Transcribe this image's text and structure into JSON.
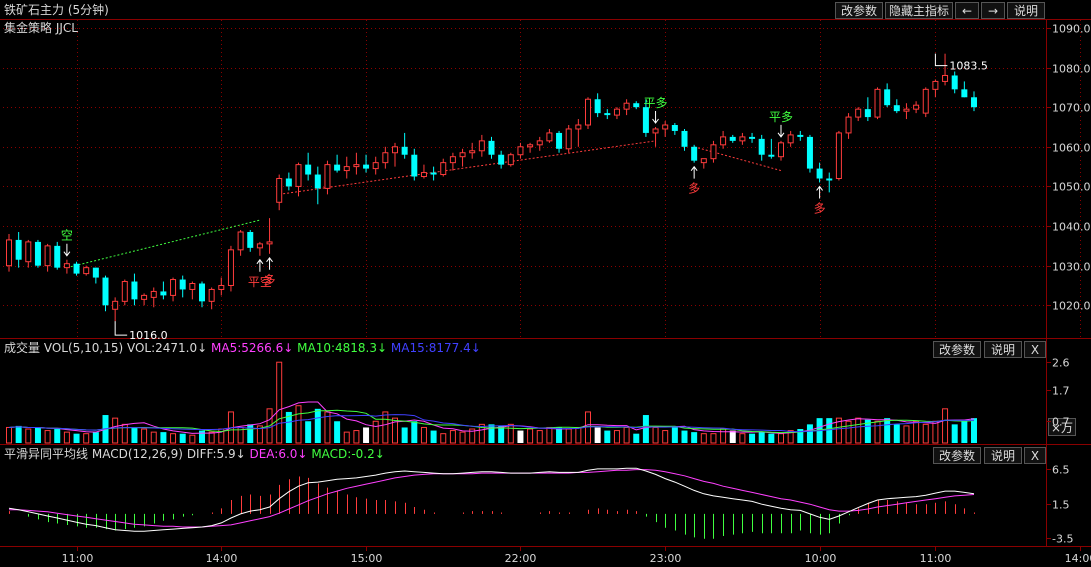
{
  "title": "铁矿石主力 (5分钟)",
  "strategy": "集金策略 JJCL",
  "toolbar": {
    "params": "改参数",
    "hide_main": "隐藏主指标",
    "left_arrow": "←",
    "right_arrow": "→",
    "help": "说明"
  },
  "vol_header": {
    "name": "成交量",
    "indicator": "VOL(5,10,15)",
    "vol": "VOL:2471.0↓",
    "ma5": "MA5:5266.6↓",
    "ma10": "MA10:4818.3↓",
    "ma15": "MA15:8177.4↓"
  },
  "vol_buttons": {
    "params": "改参数",
    "help": "说明",
    "close": "X"
  },
  "macd_header": {
    "name": "平滑异同平均线",
    "indicator": "MACD(12,26,9)",
    "diff": "DIFF:5.9↓",
    "dea": "DEA:6.0↓",
    "macd": "MACD:-0.2↓"
  },
  "macd_buttons": {
    "params": "改参数",
    "help": "说明",
    "close": "X"
  },
  "unit_label": "×万",
  "colors": {
    "up": "#ff3c3c",
    "down": "#00ffff",
    "ma5": "#ff40ff",
    "ma10": "#40ff40",
    "ma15": "#4040ff",
    "diff": "#ffffff",
    "dea": "#ff40ff",
    "signal_long": "#ff3c3c",
    "signal_flat": "#40ff40",
    "grid": "#8a0000",
    "axis_text": "#d8d8d8"
  },
  "chart_data": [
    {
      "type": "candlestick",
      "title": "铁矿石主力 (5分钟)",
      "y_ticks": [
        1020.0,
        1030.0,
        1040.0,
        1050.0,
        1060.0,
        1070.0,
        1080.0,
        1090.0
      ],
      "ylim": [
        1012,
        1092
      ],
      "ohlc": [
        [
          1030.0,
          1038.0,
          1028.5,
          1036.5
        ],
        [
          1036.5,
          1038.5,
          1029.5,
          1031.5
        ],
        [
          1031.0,
          1036.5,
          1029.5,
          1036.0
        ],
        [
          1036.0,
          1036.5,
          1029.5,
          1030.0
        ],
        [
          1030.0,
          1035.5,
          1028.5,
          1035.0
        ],
        [
          1035.0,
          1036.0,
          1029.0,
          1029.5
        ],
        [
          1029.5,
          1031.5,
          1028.0,
          1030.5
        ],
        [
          1030.5,
          1031.0,
          1027.5,
          1028.0
        ],
        [
          1028.0,
          1030.0,
          1027.5,
          1029.5
        ],
        [
          1029.5,
          1029.5,
          1025.5,
          1027.0
        ],
        [
          1027.0,
          1027.5,
          1018.5,
          1020.0
        ],
        [
          1019.0,
          1022.0,
          1016.0,
          1021.0
        ],
        [
          1021.0,
          1026.5,
          1020.0,
          1026.0
        ],
        [
          1026.0,
          1028.0,
          1020.0,
          1021.5
        ],
        [
          1021.5,
          1023.0,
          1020.0,
          1022.5
        ],
        [
          1022.0,
          1024.5,
          1019.5,
          1023.5
        ],
        [
          1023.5,
          1026.0,
          1021.5,
          1022.5
        ],
        [
          1022.5,
          1027.0,
          1021.0,
          1026.5
        ],
        [
          1026.5,
          1027.5,
          1022.0,
          1024.0
        ],
        [
          1024.0,
          1026.0,
          1021.5,
          1025.5
        ],
        [
          1025.5,
          1026.0,
          1019.5,
          1021.0
        ],
        [
          1021.0,
          1024.5,
          1019.0,
          1024.0
        ],
        [
          1024.0,
          1027.0,
          1022.5,
          1025.0
        ],
        [
          1025.0,
          1035.0,
          1023.5,
          1034.0
        ],
        [
          1034.0,
          1039.0,
          1032.5,
          1038.5
        ],
        [
          1038.5,
          1039.0,
          1033.5,
          1034.5
        ],
        [
          1034.5,
          1036.0,
          1032.5,
          1035.5
        ],
        [
          1035.5,
          1042.0,
          1033.0,
          1036.0
        ],
        [
          1046.0,
          1053.0,
          1044.0,
          1052.0
        ],
        [
          1052.0,
          1053.5,
          1049.0,
          1050.0
        ],
        [
          1050.0,
          1056.0,
          1047.5,
          1055.5
        ],
        [
          1055.5,
          1058.5,
          1051.5,
          1053.0
        ],
        [
          1053.0,
          1055.0,
          1045.5,
          1049.5
        ],
        [
          1049.5,
          1056.5,
          1048.0,
          1055.5
        ],
        [
          1055.5,
          1058.0,
          1053.5,
          1054.0
        ],
        [
          1054.0,
          1057.5,
          1052.0,
          1055.0
        ],
        [
          1055.0,
          1058.5,
          1053.0,
          1055.5
        ],
        [
          1055.5,
          1058.0,
          1053.5,
          1054.5
        ],
        [
          1054.5,
          1057.5,
          1053.0,
          1056.0
        ],
        [
          1056.0,
          1060.0,
          1054.5,
          1058.5
        ],
        [
          1058.5,
          1061.0,
          1055.0,
          1060.0
        ],
        [
          1060.0,
          1063.5,
          1057.0,
          1058.0
        ],
        [
          1058.0,
          1059.5,
          1051.5,
          1052.5
        ],
        [
          1052.5,
          1055.5,
          1052.0,
          1053.5
        ],
        [
          1053.5,
          1055.0,
          1051.5,
          1053.0
        ],
        [
          1053.0,
          1057.0,
          1052.5,
          1056.0
        ],
        [
          1056.0,
          1058.5,
          1054.0,
          1057.5
        ],
        [
          1057.5,
          1059.5,
          1055.0,
          1058.5
        ],
        [
          1058.5,
          1061.0,
          1057.0,
          1059.0
        ],
        [
          1059.0,
          1063.0,
          1057.5,
          1061.5
        ],
        [
          1061.5,
          1062.5,
          1057.0,
          1058.0
        ],
        [
          1058.0,
          1059.0,
          1054.5,
          1055.5
        ],
        [
          1055.5,
          1058.5,
          1055.0,
          1058.0
        ],
        [
          1058.0,
          1061.0,
          1057.0,
          1060.0
        ],
        [
          1060.0,
          1061.0,
          1058.5,
          1060.5
        ],
        [
          1060.5,
          1062.5,
          1059.0,
          1061.5
        ],
        [
          1061.5,
          1064.5,
          1061.0,
          1063.5
        ],
        [
          1063.5,
          1064.0,
          1058.5,
          1059.5
        ],
        [
          1059.5,
          1065.5,
          1058.5,
          1064.5
        ],
        [
          1064.5,
          1067.0,
          1060.0,
          1065.5
        ],
        [
          1065.5,
          1072.5,
          1064.5,
          1072.0
        ],
        [
          1072.0,
          1073.5,
          1067.5,
          1068.5
        ],
        [
          1068.5,
          1069.5,
          1067.0,
          1068.0
        ],
        [
          1068.0,
          1070.0,
          1067.0,
          1069.5
        ],
        [
          1069.5,
          1072.0,
          1068.0,
          1071.0
        ],
        [
          1071.0,
          1071.5,
          1069.5,
          1070.0
        ],
        [
          1070.0,
          1072.0,
          1062.5,
          1063.5
        ],
        [
          1063.5,
          1065.0,
          1060.0,
          1064.5
        ],
        [
          1064.5,
          1066.5,
          1062.5,
          1065.5
        ],
        [
          1065.5,
          1066.0,
          1063.0,
          1064.0
        ],
        [
          1064.0,
          1064.5,
          1059.0,
          1060.0
        ],
        [
          1060.0,
          1060.5,
          1056.0,
          1056.5
        ],
        [
          1056.0,
          1057.0,
          1054.5,
          1057.0
        ],
        [
          1057.0,
          1061.5,
          1056.0,
          1060.5
        ],
        [
          1060.5,
          1064.0,
          1059.5,
          1062.5
        ],
        [
          1062.5,
          1063.0,
          1061.0,
          1061.5
        ],
        [
          1061.5,
          1063.5,
          1060.5,
          1062.5
        ],
        [
          1062.5,
          1063.5,
          1061.0,
          1062.0
        ],
        [
          1062.0,
          1063.0,
          1056.5,
          1058.0
        ],
        [
          1058.0,
          1062.0,
          1057.0,
          1057.5
        ],
        [
          1057.5,
          1061.5,
          1056.5,
          1061.0
        ],
        [
          1061.0,
          1064.0,
          1060.0,
          1063.0
        ],
        [
          1063.0,
          1064.0,
          1061.5,
          1062.5
        ],
        [
          1062.5,
          1063.0,
          1053.5,
          1054.5
        ],
        [
          1054.5,
          1056.0,
          1051.0,
          1052.0
        ],
        [
          1052.0,
          1053.5,
          1048.5,
          1051.5
        ],
        [
          1052.0,
          1064.0,
          1051.5,
          1063.5
        ],
        [
          1063.5,
          1068.5,
          1062.0,
          1067.5
        ],
        [
          1067.5,
          1070.0,
          1066.5,
          1069.5
        ],
        [
          1069.5,
          1072.5,
          1066.5,
          1067.5
        ],
        [
          1067.5,
          1075.0,
          1067.0,
          1074.5
        ],
        [
          1074.5,
          1076.0,
          1070.0,
          1070.5
        ],
        [
          1070.5,
          1072.0,
          1068.5,
          1069.0
        ],
        [
          1069.0,
          1071.0,
          1067.0,
          1069.5
        ],
        [
          1069.5,
          1071.5,
          1068.5,
          1070.5
        ],
        [
          1068.5,
          1075.0,
          1067.5,
          1074.5
        ],
        [
          1074.5,
          1077.0,
          1072.5,
          1076.5
        ],
        [
          1076.5,
          1083.5,
          1075.5,
          1078.0
        ],
        [
          1078.0,
          1079.0,
          1073.5,
          1074.5
        ],
        [
          1074.5,
          1076.5,
          1072.5,
          1072.5
        ],
        [
          1072.5,
          1074.0,
          1069.0,
          1070.0
        ]
      ],
      "price_labels": [
        {
          "text": "1016.0",
          "bar": 11,
          "value": 1016.0
        },
        {
          "text": "1083.5",
          "bar": 96,
          "value": 1083.5
        }
      ],
      "signals": [
        {
          "label": "空",
          "bar": 6,
          "type": "flat",
          "arrow": "down"
        },
        {
          "label": "平空",
          "bar": 26,
          "type": "long",
          "arrow": "up"
        },
        {
          "label": "多",
          "bar": 27,
          "type": "long",
          "arrow": "up"
        },
        {
          "label": "平多",
          "bar": 67,
          "type": "flat",
          "arrow": "down"
        },
        {
          "label": "多",
          "bar": 71,
          "type": "long",
          "arrow": "up"
        },
        {
          "label": "平多",
          "bar": 80,
          "type": "flat",
          "arrow": "down"
        },
        {
          "label": "多",
          "bar": 84,
          "type": "long",
          "arrow": "up"
        }
      ],
      "trend_lines": [
        {
          "color": "flat",
          "from": [
            6,
            1029.5
          ],
          "to": [
            26,
            1041.5
          ]
        },
        {
          "color": "long",
          "from": [
            28,
            1048.0
          ],
          "to": [
            67,
            1061.5
          ]
        },
        {
          "color": "long",
          "from": [
            71,
            1060.0
          ],
          "to": [
            80,
            1054.0
          ]
        }
      ]
    },
    {
      "type": "bar",
      "title": "VOL(5,10,15)",
      "y_ticks": [
        0.7,
        1.7,
        2.6
      ],
      "ylim": [
        0,
        2.8
      ],
      "values": [
        0.5,
        0.55,
        0.45,
        0.5,
        0.4,
        0.45,
        0.35,
        0.3,
        0.3,
        0.35,
        0.9,
        0.8,
        0.6,
        0.5,
        0.45,
        0.35,
        0.35,
        0.3,
        0.3,
        0.25,
        0.4,
        0.35,
        0.45,
        1.0,
        0.5,
        0.6,
        0.55,
        1.1,
        2.6,
        1.0,
        1.2,
        0.7,
        1.1,
        1.0,
        0.7,
        0.35,
        0.4,
        0.5,
        0.7,
        1.0,
        0.8,
        0.5,
        0.7,
        0.5,
        0.4,
        0.3,
        0.4,
        0.35,
        0.45,
        0.6,
        0.6,
        0.55,
        0.6,
        0.4,
        0.45,
        0.4,
        0.5,
        0.5,
        0.45,
        0.5,
        1.0,
        0.5,
        0.4,
        0.4,
        0.5,
        0.3,
        0.9,
        0.5,
        0.4,
        0.5,
        0.4,
        0.35,
        0.3,
        0.3,
        0.45,
        0.4,
        0.3,
        0.3,
        0.35,
        0.3,
        0.3,
        0.4,
        0.45,
        0.6,
        0.8,
        0.8,
        0.8,
        0.7,
        0.8,
        0.75,
        0.7,
        0.8,
        0.6,
        0.55,
        0.7,
        0.6,
        0.7,
        1.1,
        0.6,
        0.7,
        0.8
      ],
      "white_bars": [
        37,
        53,
        61,
        75
      ]
    },
    {
      "type": "macd",
      "title": "MACD(12,26,9)",
      "y_ticks": [
        -3.5,
        1.5,
        6.5
      ],
      "ylim": [
        -4.5,
        7.5
      ],
      "diff": [
        0.8,
        0.6,
        0.3,
        0.0,
        -0.3,
        -0.6,
        -0.9,
        -1.2,
        -1.5,
        -1.7,
        -2.0,
        -2.3,
        -2.4,
        -2.5,
        -2.5,
        -2.4,
        -2.3,
        -2.2,
        -2.1,
        -2.0,
        -1.9,
        -1.7,
        -1.3,
        -0.6,
        0.0,
        0.4,
        0.6,
        1.0,
        2.2,
        3.2,
        4.0,
        4.5,
        4.6,
        4.8,
        5.0,
        5.1,
        5.2,
        5.4,
        5.6,
        5.9,
        6.1,
        6.2,
        6.1,
        6.0,
        5.9,
        5.8,
        5.8,
        5.9,
        6.0,
        6.1,
        6.1,
        6.0,
        5.9,
        5.9,
        5.9,
        6.0,
        6.1,
        6.0,
        6.0,
        6.0,
        6.3,
        6.5,
        6.5,
        6.5,
        6.6,
        6.6,
        6.2,
        5.7,
        5.1,
        4.6,
        4.0,
        3.4,
        2.9,
        2.6,
        2.4,
        2.2,
        2.0,
        1.8,
        1.4,
        1.1,
        0.8,
        0.6,
        0.5,
        0.0,
        -0.5,
        -0.8,
        -0.3,
        0.3,
        0.9,
        1.5,
        2.0,
        2.2,
        2.3,
        2.4,
        2.5,
        2.7,
        3.0,
        3.3,
        3.3,
        3.1,
        2.9
      ],
      "dea": [
        0.6,
        0.6,
        0.5,
        0.4,
        0.3,
        0.1,
        -0.1,
        -0.3,
        -0.5,
        -0.7,
        -0.9,
        -1.1,
        -1.3,
        -1.5,
        -1.6,
        -1.7,
        -1.8,
        -1.8,
        -1.9,
        -1.9,
        -1.9,
        -1.8,
        -1.7,
        -1.6,
        -1.3,
        -1.0,
        -0.7,
        -0.4,
        0.1,
        0.7,
        1.3,
        1.9,
        2.4,
        2.9,
        3.3,
        3.7,
        4.0,
        4.3,
        4.6,
        4.9,
        5.2,
        5.4,
        5.6,
        5.7,
        5.8,
        5.8,
        5.8,
        5.8,
        5.8,
        5.9,
        5.9,
        5.9,
        5.9,
        5.9,
        5.9,
        5.9,
        5.9,
        5.9,
        5.9,
        6.0,
        6.0,
        6.1,
        6.2,
        6.3,
        6.3,
        6.4,
        6.4,
        6.3,
        6.1,
        5.8,
        5.5,
        5.1,
        4.7,
        4.4,
        4.0,
        3.7,
        3.4,
        3.1,
        2.8,
        2.5,
        2.2,
        2.0,
        1.7,
        1.4,
        1.0,
        0.6,
        0.4,
        0.4,
        0.5,
        0.7,
        1.0,
        1.2,
        1.4,
        1.6,
        1.8,
        2.0,
        2.2,
        2.4,
        2.6,
        2.7,
        2.8
      ],
      "macd": [
        0.4,
        0.0,
        -0.4,
        -0.8,
        -1.2,
        -1.4,
        -1.6,
        -1.8,
        -2.0,
        -2.0,
        -2.2,
        -2.4,
        -2.2,
        -2.0,
        -1.8,
        -1.4,
        -1.0,
        -0.8,
        -0.4,
        -0.2,
        0.0,
        0.2,
        0.8,
        2.0,
        2.6,
        2.8,
        2.6,
        2.8,
        4.2,
        5.0,
        5.4,
        5.2,
        4.4,
        3.8,
        3.4,
        2.8,
        2.4,
        2.2,
        2.0,
        2.0,
        1.8,
        1.6,
        1.0,
        0.6,
        0.2,
        0.0,
        0.0,
        0.2,
        0.4,
        0.4,
        0.4,
        0.2,
        0.0,
        0.0,
        0.0,
        0.2,
        0.4,
        0.2,
        0.2,
        0.0,
        0.6,
        0.8,
        0.6,
        0.4,
        0.6,
        0.4,
        -0.4,
        -1.2,
        -2.0,
        -2.4,
        -3.0,
        -3.4,
        -3.6,
        -3.6,
        -3.2,
        -3.0,
        -2.8,
        -2.6,
        -2.8,
        -2.8,
        -2.8,
        -2.8,
        -2.4,
        -2.8,
        -3.0,
        -2.8,
        -1.4,
        -0.2,
        0.8,
        1.6,
        2.0,
        2.0,
        1.8,
        1.6,
        1.4,
        1.4,
        1.6,
        1.8,
        1.4,
        0.8,
        0.2
      ]
    }
  ],
  "x_ticks": [
    {
      "label": "11:00",
      "bar": 7
    },
    {
      "label": "14:00",
      "bar": 22
    },
    {
      "label": "15:00",
      "bar": 37
    },
    {
      "label": "22:00",
      "bar": 53
    },
    {
      "label": "23:00",
      "bar": 68
    },
    {
      "label": "10:00",
      "bar": 84
    },
    {
      "label": "11:00",
      "bar": 96
    },
    {
      "label": "14:00",
      "bar": 111
    }
  ]
}
